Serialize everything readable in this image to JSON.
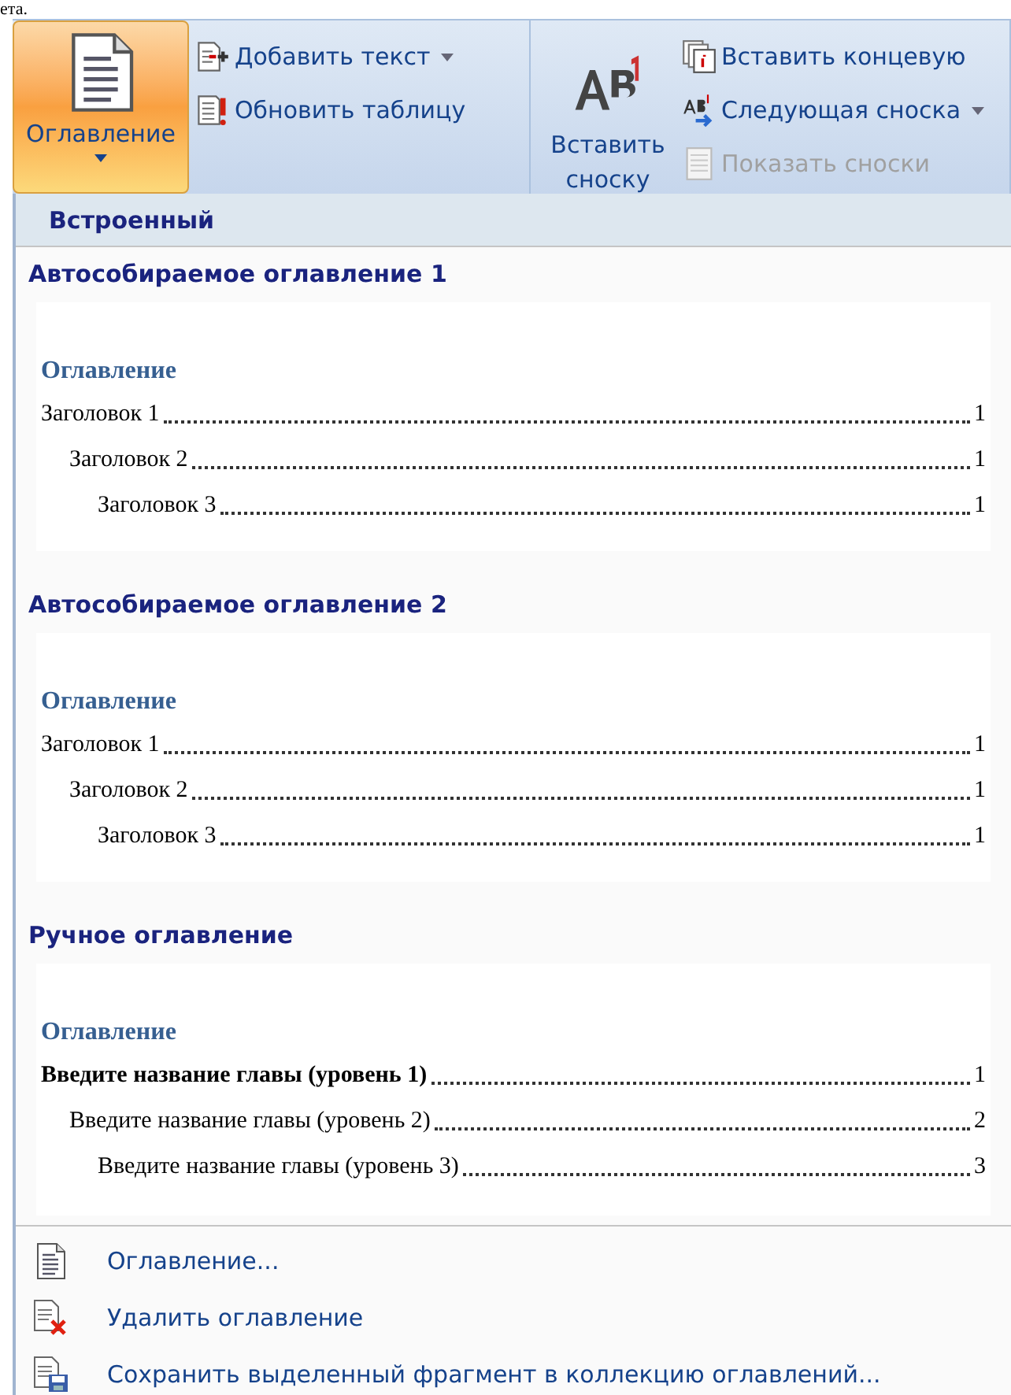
{
  "document_fragment": "ета.",
  "ribbon": {
    "groups": [
      {
        "large_button": {
          "label": "Оглавление",
          "kind": "toc",
          "pressed": true,
          "dropdown": true
        },
        "small_buttons": [
          {
            "label": "Добавить текст",
            "kind": "add_text",
            "dropdown": true,
            "disabled": false
          },
          {
            "label": "Обновить таблицу",
            "kind": "update",
            "dropdown": false,
            "disabled": false
          }
        ]
      },
      {
        "large_button": {
          "label": "Вставить сноску",
          "kind": "footnote",
          "pressed": false
        },
        "small_buttons": [
          {
            "label": "Вставить концевую",
            "kind": "endnote",
            "dropdown": false,
            "disabled": false
          },
          {
            "label": "Следующая сноска",
            "kind": "next_footnote",
            "dropdown": true,
            "disabled": false
          },
          {
            "label": "Показать сноски",
            "kind": "show_notes",
            "dropdown": false,
            "disabled": true
          }
        ]
      }
    ]
  },
  "gallery": {
    "category": "Встроенный",
    "items": [
      {
        "title": "Автособираемое оглавление 1",
        "preview": {
          "heading": "Оглавление",
          "entries": [
            {
              "text": "Заголовок 1",
              "page": "1",
              "bold": false,
              "children": [
                {
                  "text": "Заголовок 2",
                  "page": "1",
                  "bold": false,
                  "children": [
                    {
                      "text": "Заголовок 3",
                      "page": "1",
                      "bold": false
                    }
                  ]
                }
              ]
            }
          ]
        }
      },
      {
        "title": "Автособираемое оглавление 2",
        "preview": {
          "heading": "Оглавление",
          "entries": [
            {
              "text": "Заголовок 1",
              "page": "1",
              "bold": false,
              "children": [
                {
                  "text": "Заголовок 2",
                  "page": "1",
                  "bold": false,
                  "children": [
                    {
                      "text": "Заголовок 3",
                      "page": "1",
                      "bold": false
                    }
                  ]
                }
              ]
            }
          ]
        }
      },
      {
        "title": "Ручное оглавление",
        "preview": {
          "heading": "Оглавление",
          "entries": [
            {
              "text": "Введите название главы (уровень 1)",
              "page": "1",
              "bold": true,
              "children": [
                {
                  "text": "Введите название главы (уровень 2)",
                  "page": "2",
                  "bold": false,
                  "children": [
                    {
                      "text": "Введите название главы (уровень 3)",
                      "page": "3",
                      "bold": false
                    }
                  ]
                }
              ]
            }
          ]
        }
      }
    ]
  },
  "menu": [
    {
      "label": "Оглавление...",
      "kind": "toc"
    },
    {
      "label": "Удалить оглавление",
      "kind": "delete"
    },
    {
      "label": "Сохранить выделенный фрагмент в коллекцию оглавлений...",
      "kind": "save"
    }
  ]
}
